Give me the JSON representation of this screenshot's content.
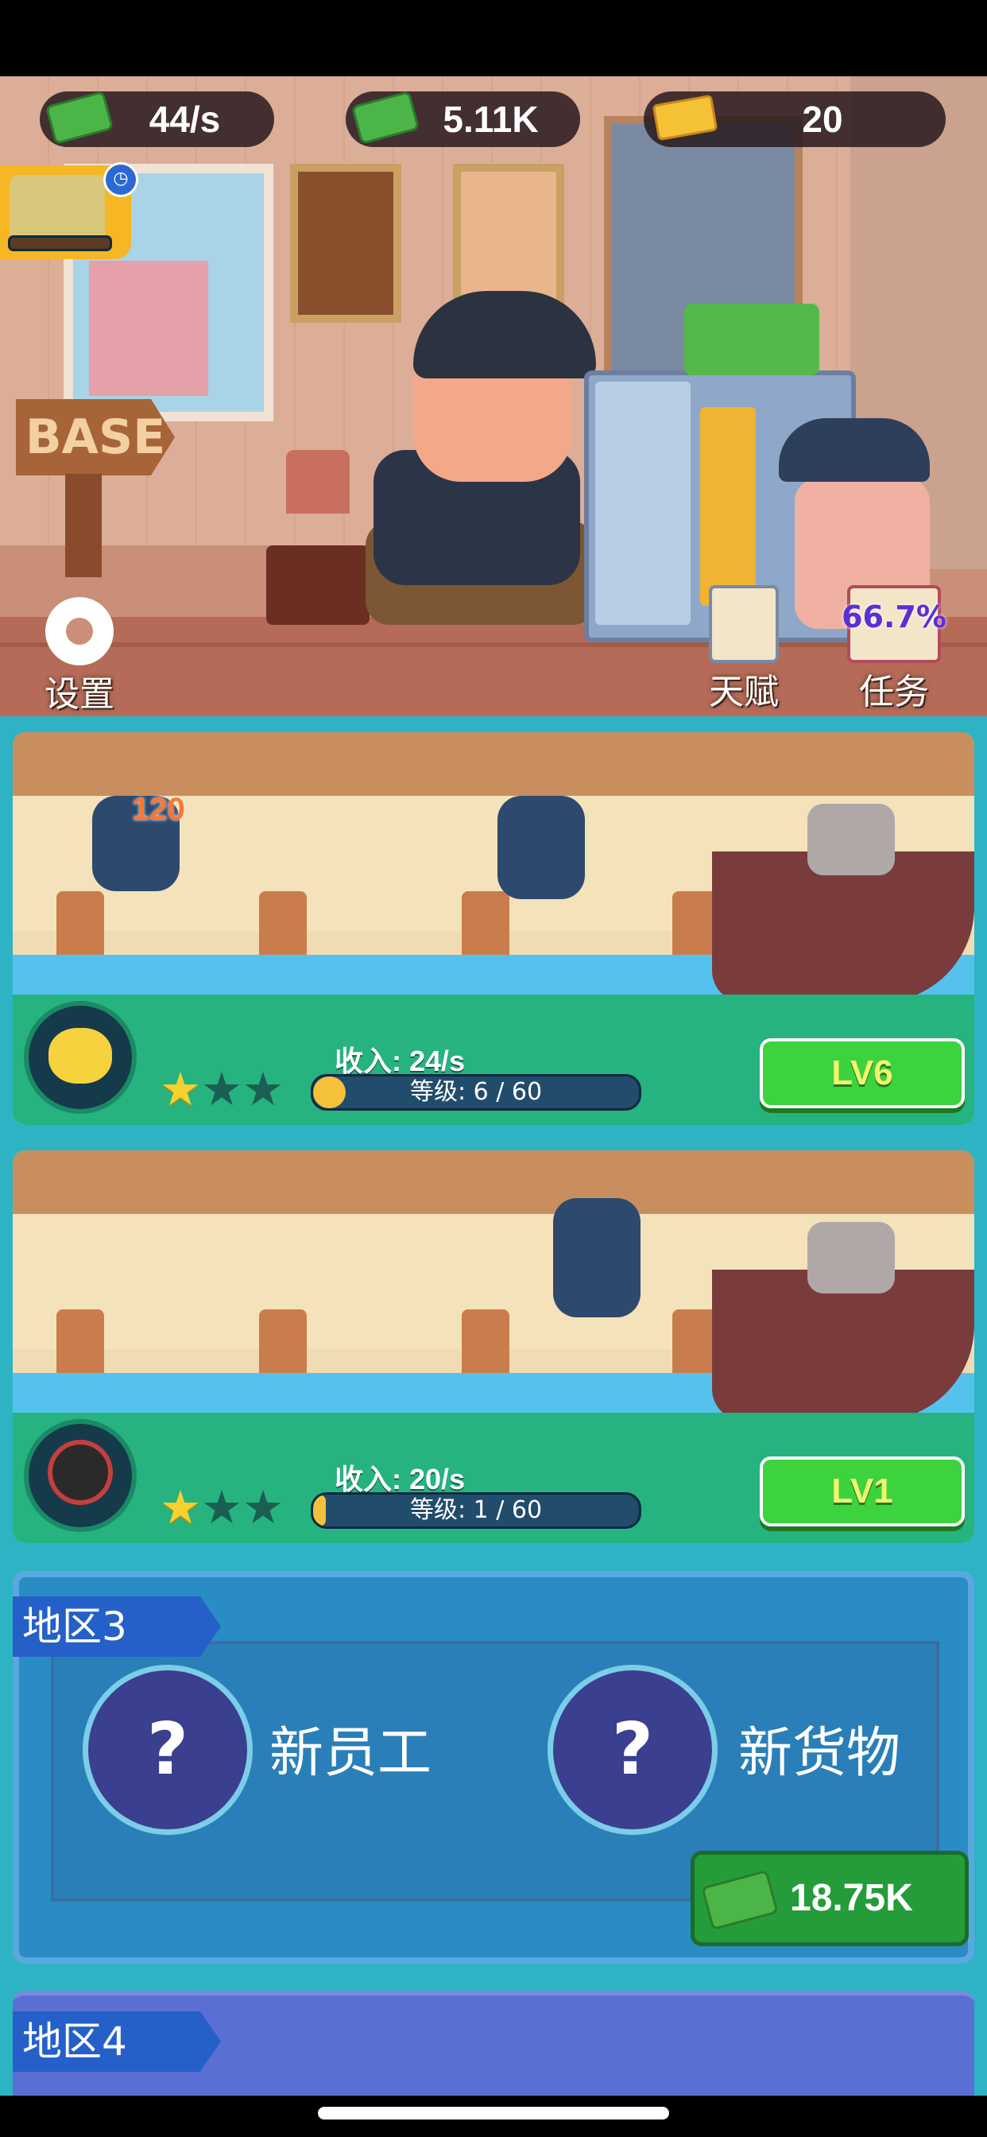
{
  "currency": {
    "rate": "44/s",
    "cash": "5.11K",
    "gold": "20"
  },
  "base": {
    "sign": "BASE",
    "settings_label": "设置",
    "talent_label": "天赋",
    "task_label": "任务",
    "task_progress": "66.7%"
  },
  "rooms": [
    {
      "income_label": "收入:",
      "income_value": "24/s",
      "level_text": "等级: 6 / 60",
      "level_fraction": 0.1,
      "stars_filled": 1,
      "stars_total": 3,
      "level_button": "LV6",
      "float_cash": "120",
      "avatar": "chick-icon"
    },
    {
      "income_label": "收入:",
      "income_value": "20/s",
      "level_text": "等级: 1 / 60",
      "level_fraction": 0.017,
      "stars_filled": 1,
      "stars_total": 3,
      "level_button": "LV1",
      "avatar": "frying-pan-icon"
    }
  ],
  "region3": {
    "tag": "地区3",
    "new_employee": "新员工",
    "new_goods": "新货物",
    "price": "18.75K"
  },
  "region4": {
    "tag": "地区4"
  },
  "colors": {
    "level_button": "#3cd33f",
    "star_on": "#f5d22e",
    "panel_green": "#26b37f",
    "region3_blue": "#2a8cc4",
    "region4_blue": "#5a6fd4"
  }
}
